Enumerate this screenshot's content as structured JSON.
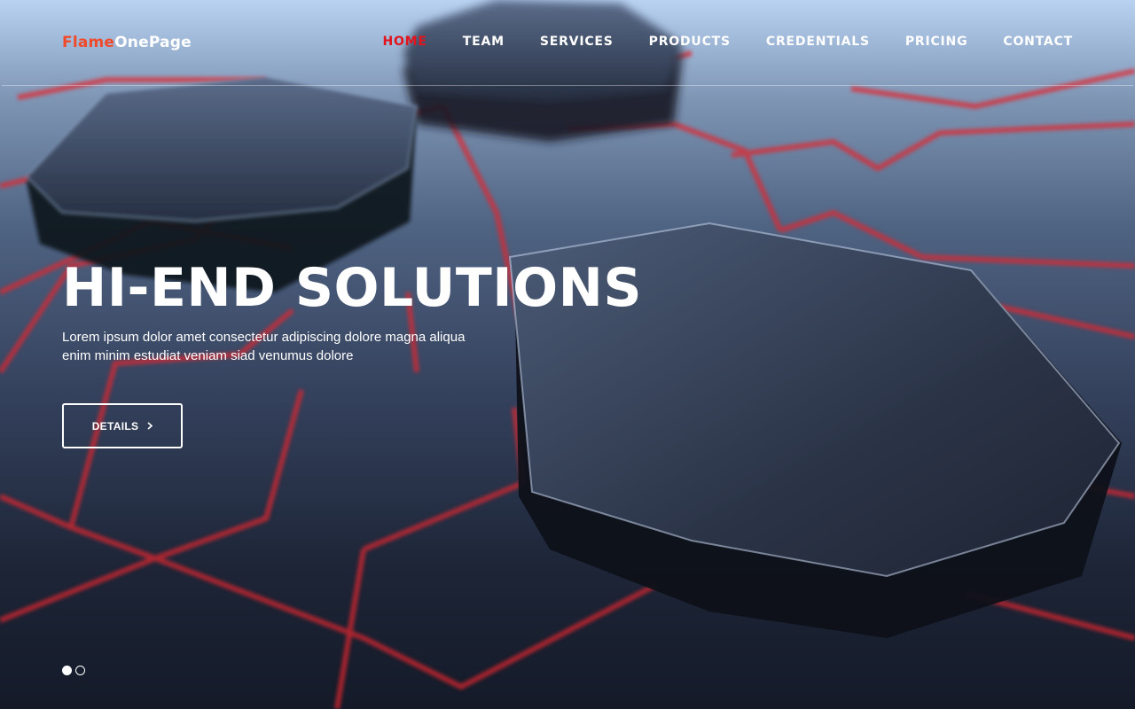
{
  "brand": {
    "part1": "Flame",
    "part2": "OnePage",
    "accent": "#e3131b"
  },
  "nav": {
    "items": [
      {
        "label": "HOME",
        "active": true
      },
      {
        "label": "TEAM",
        "active": false
      },
      {
        "label": "SERVICES",
        "active": false
      },
      {
        "label": "PRODUCTS",
        "active": false
      },
      {
        "label": "CREDENTIALS",
        "active": false
      },
      {
        "label": "PRICING",
        "active": false
      },
      {
        "label": "CONTACT",
        "active": false
      }
    ]
  },
  "hero": {
    "title": "HI-END SOLUTIONS",
    "text": "Lorem ipsum dolor amet consectetur adipiscing dolore magna aliqua enim minim estudiat veniam siad venumus dolore",
    "button_label": "DETAILS",
    "button_icon": "chevron-right-icon"
  },
  "slider": {
    "count": 2,
    "current": 1
  }
}
